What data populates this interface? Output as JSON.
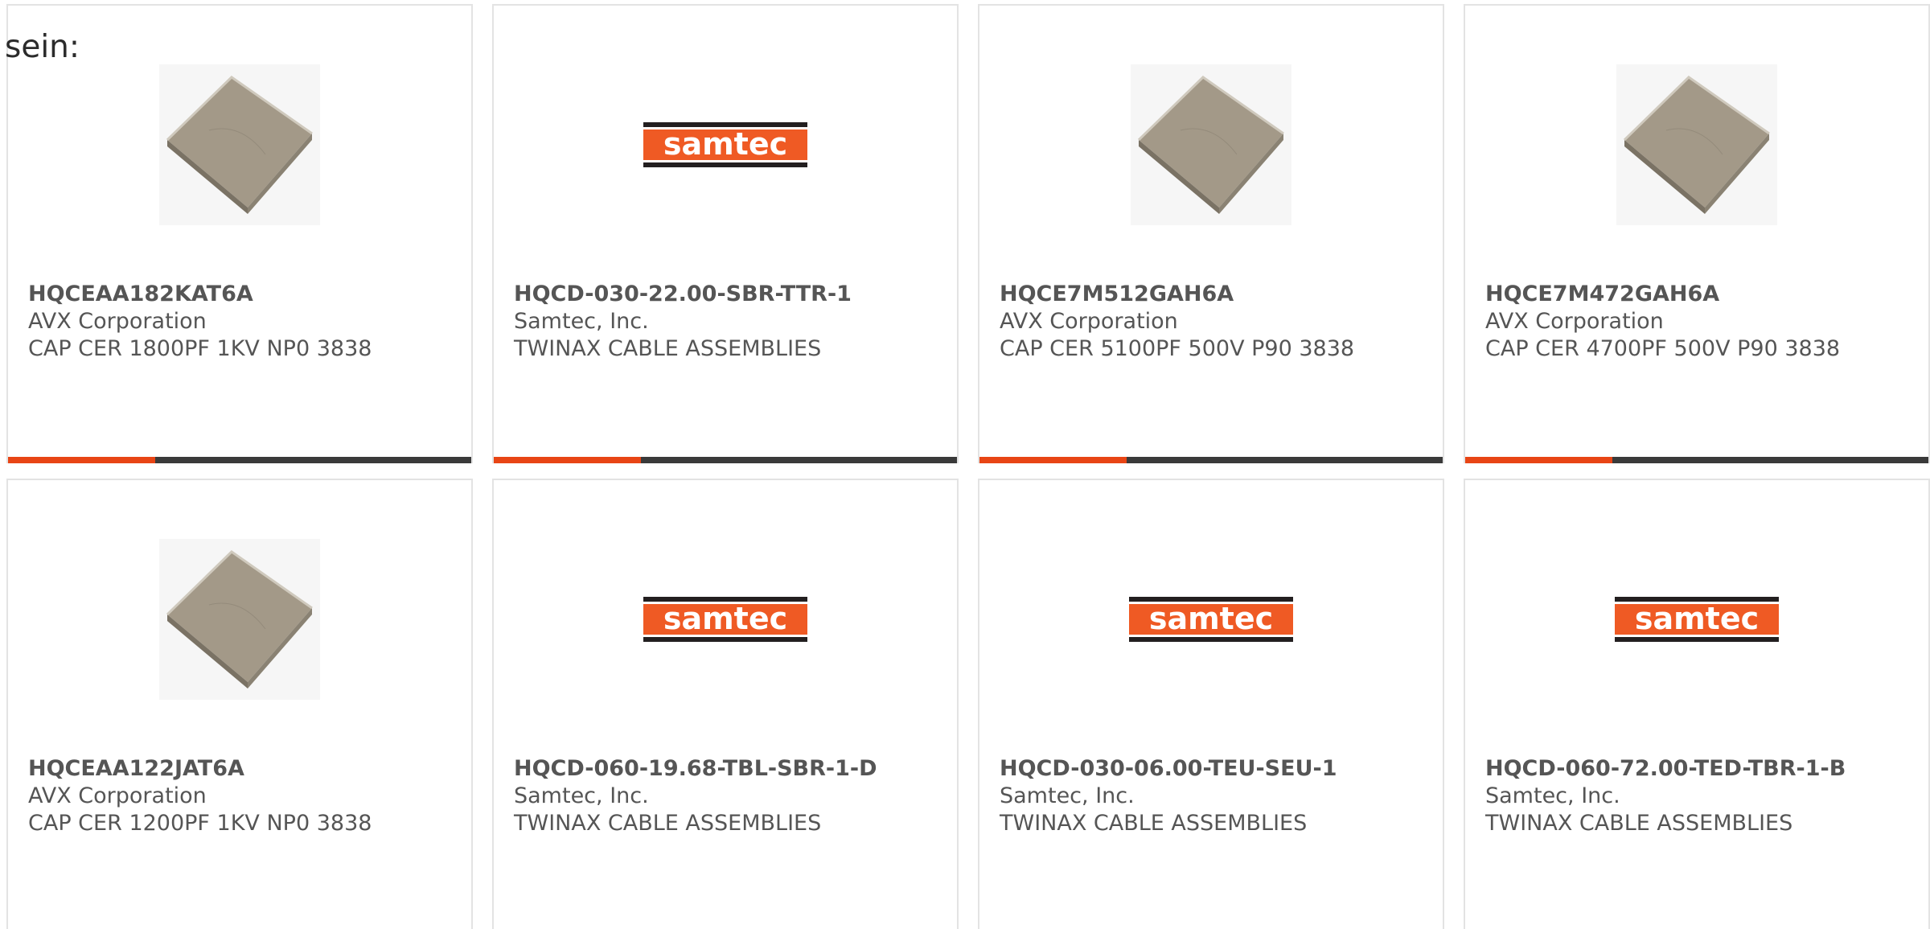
{
  "page": {
    "intro_text": "sein:"
  },
  "colors": {
    "accent": "#e84515",
    "bar_dark": "#3a3a3a",
    "text": "#555555",
    "samtec_orange": "#ef5a24",
    "samtec_dark": "#231f20"
  },
  "products": [
    {
      "part_number": "HQCEAA182KAT6A",
      "manufacturer": "AVX Corporation",
      "description": "CAP CER 1800PF 1KV NP0 3838",
      "image": "ceramic-chip-capacitor"
    },
    {
      "part_number": "HQCD-030-22.00-SBR-TTR-1",
      "manufacturer": "Samtec, Inc.",
      "description": "TWINAX CABLE ASSEMBLIES",
      "image": "samtec-logo",
      "logo_text": "samtec"
    },
    {
      "part_number": "HQCE7M512GAH6A",
      "manufacturer": "AVX Corporation",
      "description": "CAP CER 5100PF 500V P90 3838",
      "image": "ceramic-chip-capacitor"
    },
    {
      "part_number": "HQCE7M472GAH6A",
      "manufacturer": "AVX Corporation",
      "description": "CAP CER 4700PF 500V P90 3838",
      "image": "ceramic-chip-capacitor"
    },
    {
      "part_number": "HQCEAA122JAT6A",
      "manufacturer": "AVX Corporation",
      "description": "CAP CER 1200PF 1KV NP0 3838",
      "image": "ceramic-chip-capacitor"
    },
    {
      "part_number": "HQCD-060-19.68-TBL-SBR-1-D",
      "manufacturer": "Samtec, Inc.",
      "description": "TWINAX CABLE ASSEMBLIES",
      "image": "samtec-logo",
      "logo_text": "samtec"
    },
    {
      "part_number": "HQCD-030-06.00-TEU-SEU-1",
      "manufacturer": "Samtec, Inc.",
      "description": "TWINAX CABLE ASSEMBLIES",
      "image": "samtec-logo",
      "logo_text": "samtec"
    },
    {
      "part_number": "HQCD-060-72.00-TED-TBR-1-B",
      "manufacturer": "Samtec, Inc.",
      "description": "TWINAX CABLE ASSEMBLIES",
      "image": "samtec-logo",
      "logo_text": "samtec"
    }
  ]
}
